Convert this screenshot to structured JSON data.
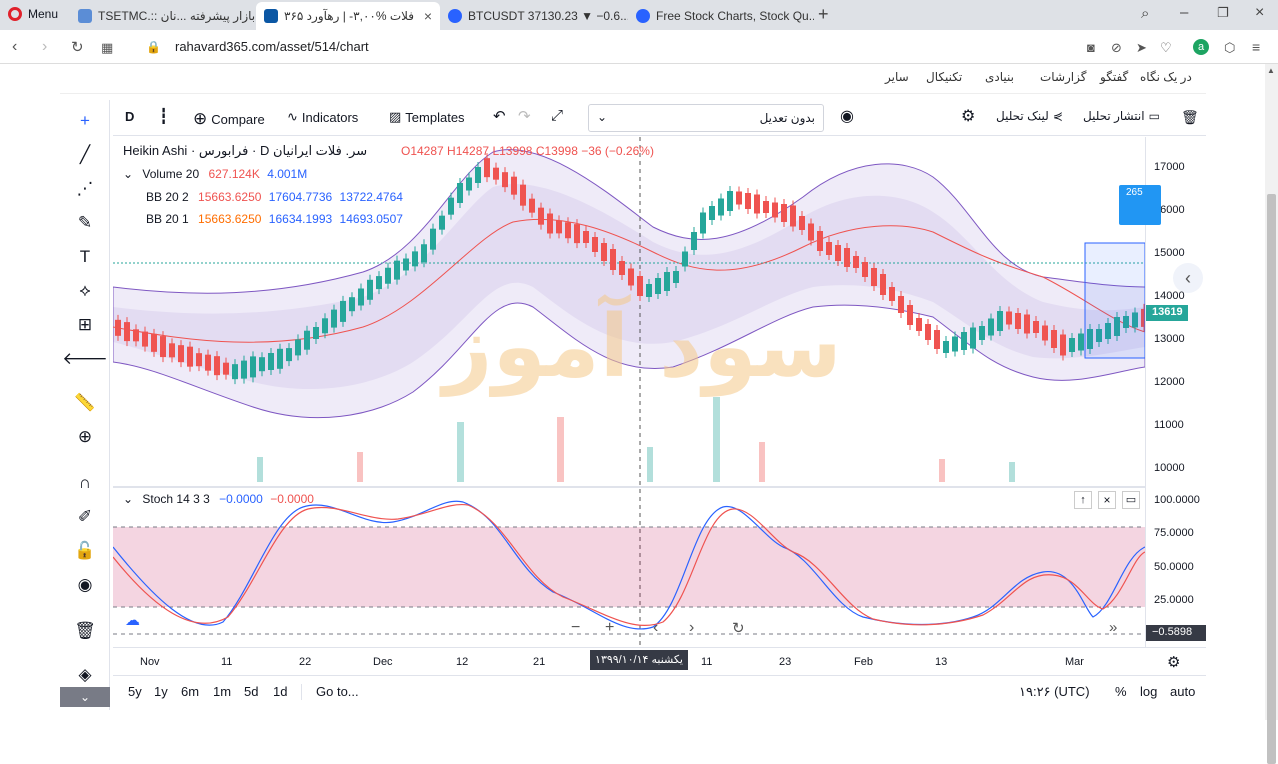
{
  "browser": {
    "menu_label": "Menu",
    "tabs": [
      {
        "title": "TSETMC.:: بازار پیشرفته ...نان",
        "color": "#5b8dd6"
      },
      {
        "title": "فلات %۳,۰۰- | رهآورد ۳۶۵",
        "color": "#0b57a4"
      },
      {
        "title": "BTCUSDT 37130.23 ▼ −0.6...",
        "color": "#2962ff"
      },
      {
        "title": "Free Stock Charts, Stock Qu...",
        "color": "#2962ff"
      }
    ],
    "url": "rahavard365.com/asset/514/chart"
  },
  "site_nav": {
    "items": [
      "در یک نگاه",
      "گفتگو",
      "گزارشات",
      "بنیادی",
      "تکنیکال",
      "سایر"
    ]
  },
  "toolbar": {
    "interval": "D",
    "compare": "Compare",
    "indicators": "Indicators",
    "templates": "Templates",
    "adjust_select": "بدون تعدیل",
    "link": "لینک تحلیل",
    "publish": "انتشار تحلیل"
  },
  "legend": {
    "symbol": "سر. فلات ایرانیان",
    "dot1": "·",
    "interval": "D",
    "exchange": "فرابورس",
    "dot2": "·",
    "style": "Heikin Ashi",
    "open": "O14287",
    "high": "H14287",
    "low": "L13998",
    "close": "C13998",
    "change": "−36 (−0.26%)",
    "volume_label": "Volume 20",
    "volume_v1": "627.124K",
    "volume_v2": "4.001M",
    "bb1_label": "BB 20 2",
    "bb1_v1": "15663.6250",
    "bb1_v2": "17604.7736",
    "bb1_v3": "13722.4764",
    "bb2_label": "BB 20 1",
    "bb2_v1": "15663.6250",
    "bb2_v2": "16634.1993",
    "bb2_v3": "14693.0507",
    "stoch_label": "Stoch 14 3 3",
    "stoch_v1": "−0.0000",
    "stoch_v2": "−0.0000"
  },
  "watermark": "سود آموز",
  "price_axis": [
    "17000",
    "16000",
    "15000",
    "14000",
    "13000",
    "12000",
    "11000",
    "10000"
  ],
  "price_badges": {
    "current": "13619",
    "side": "265"
  },
  "stoch_axis": [
    "100.0000",
    "75.0000",
    "50.0000",
    "25.0000"
  ],
  "stoch_badge": "−0.5898",
  "time_axis": [
    "Nov",
    "11",
    "22",
    "Dec",
    "12",
    "21",
    "11",
    "23",
    "Feb",
    "13",
    "Mar"
  ],
  "crosshair_date": "یکشنبه ۱۳۹۹/۱۰/۱۴",
  "bottom": {
    "ranges": [
      "5y",
      "1y",
      "6m",
      "1m",
      "5d",
      "1d"
    ],
    "goto": "Go to...",
    "clock": "۱۹:۲۶ (UTC)",
    "pct": "%",
    "log": "log",
    "auto": "auto"
  },
  "colors": {
    "up": "#26a69a",
    "down": "#ef5350",
    "band": "#7e57c2",
    "accent": "#2962ff"
  }
}
